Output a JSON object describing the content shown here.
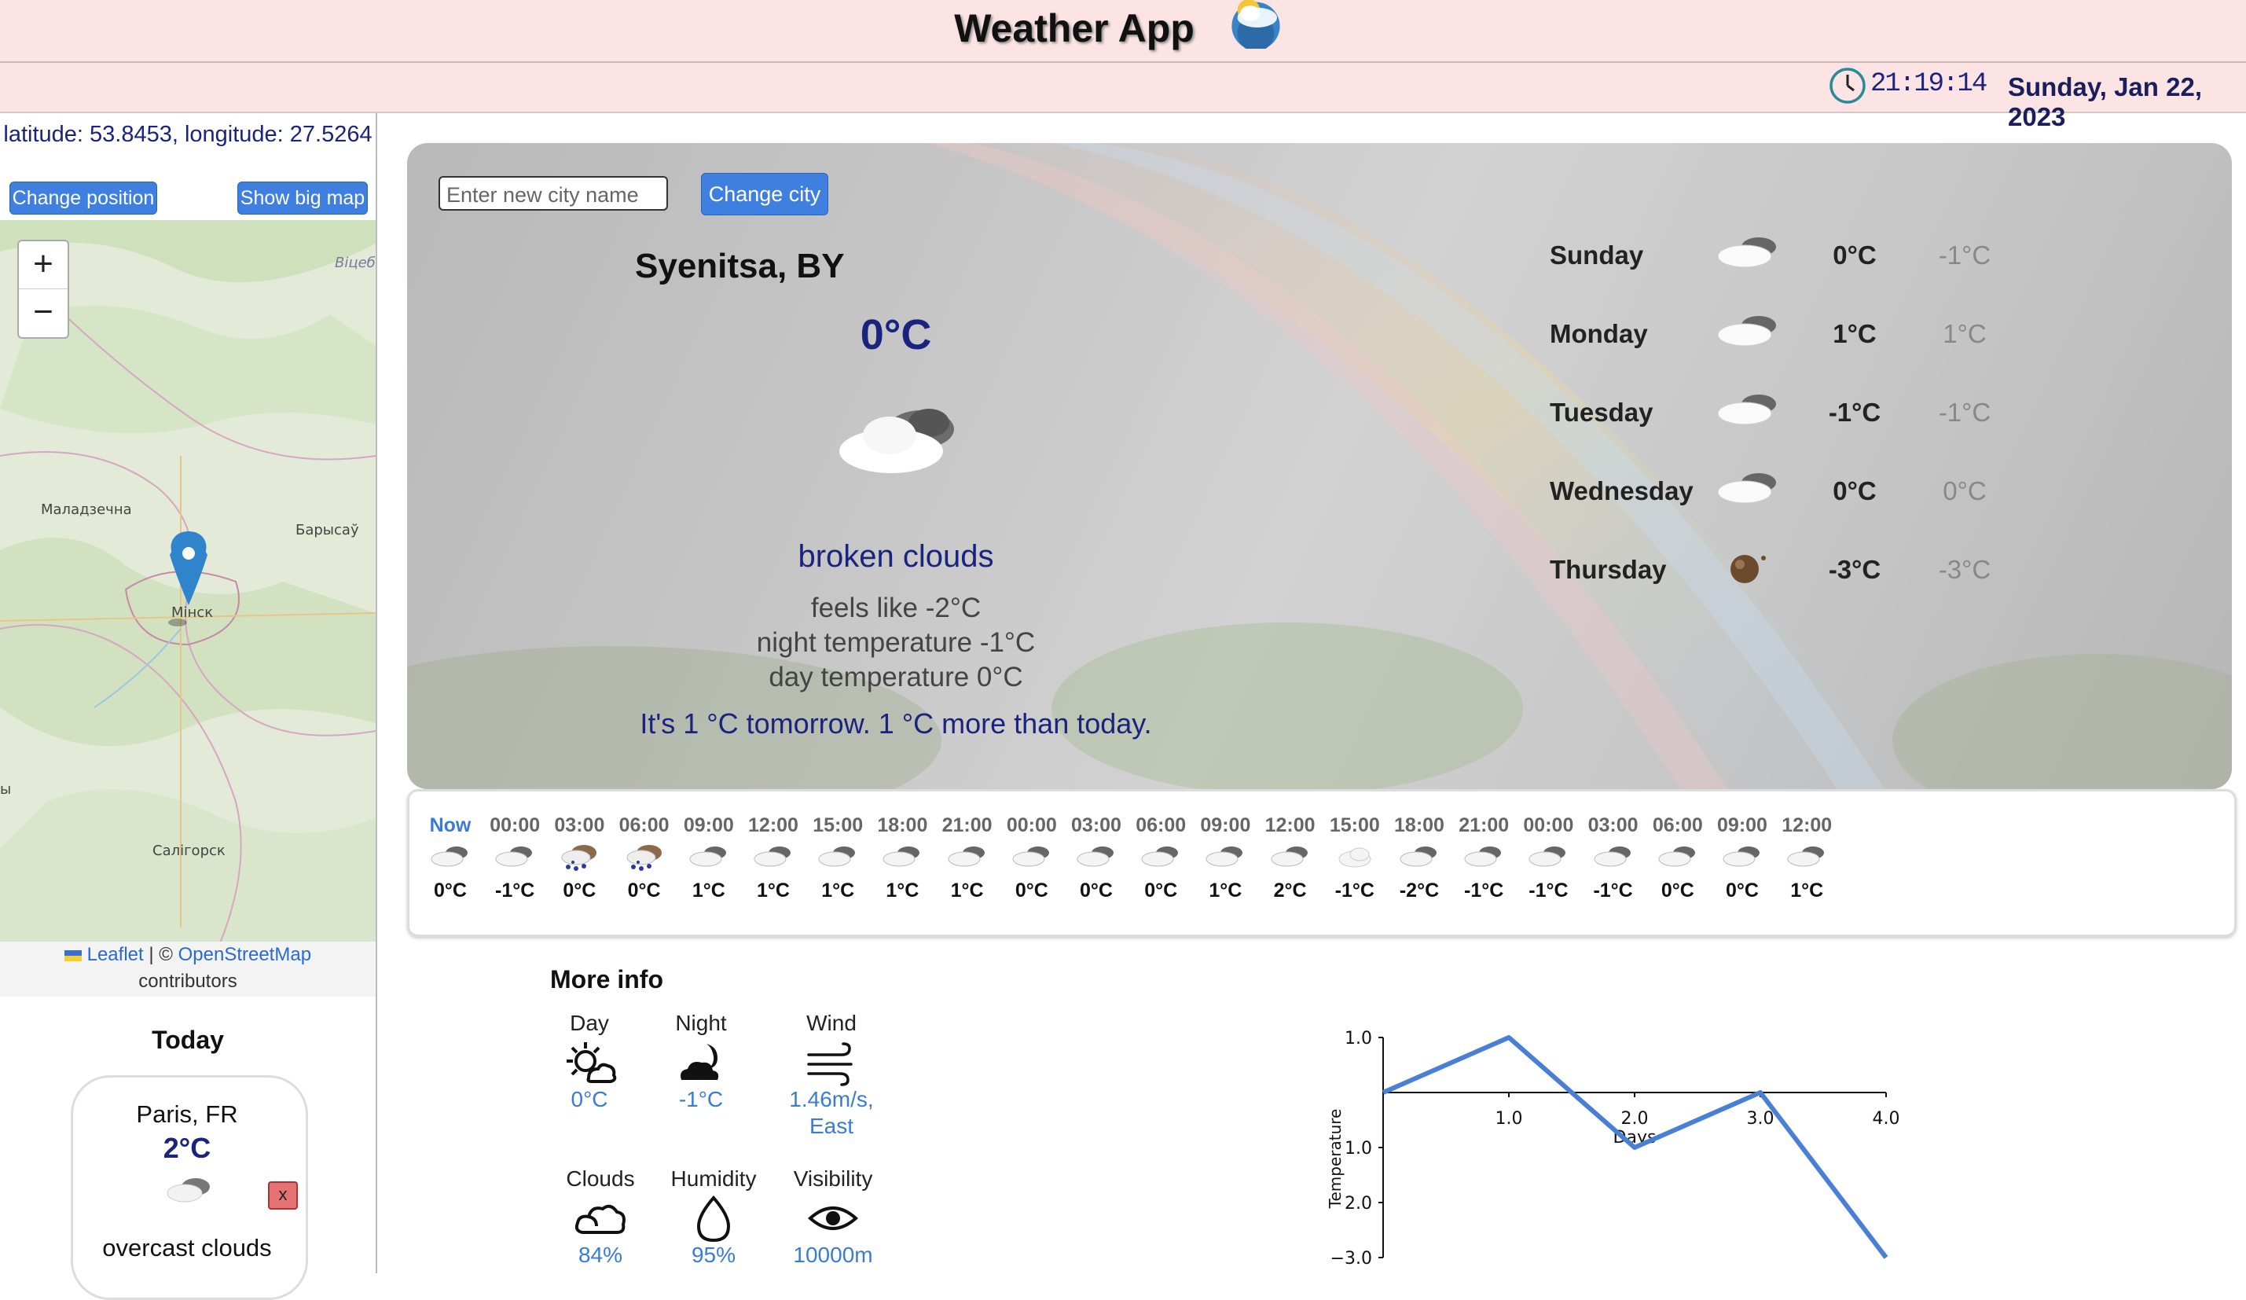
{
  "header": {
    "title": "Weather App",
    "time": "21:19:14",
    "date": "Sunday, Jan 22, 2023"
  },
  "location": {
    "coords": "latitude: 53.8453, longitude: 27.5264",
    "change_position": "Change position",
    "show_big_map": "Show big map"
  },
  "map": {
    "zoom_in": "+",
    "zoom_out": "−",
    "labels": [
      "Віцеб вобл",
      "Маладзечна",
      "Барысаў",
      "Мінск",
      "Салігорск",
      "ы"
    ],
    "attribution_leaflet": "Leaflet",
    "attribution_sep": "| ©",
    "attribution_osm": "OpenStreetMap",
    "attribution_tail": "contributors"
  },
  "today": {
    "title": "Today",
    "city": "Paris, FR",
    "temp": "2°C",
    "desc": "overcast clouds",
    "remove": "x"
  },
  "search": {
    "placeholder": "Enter new city name",
    "button": "Change city"
  },
  "current": {
    "city": "Syenitsa, BY",
    "temp": "0°C",
    "icon": "broken-clouds-icon",
    "desc": "broken clouds",
    "feels": "feels like -2°C",
    "night": "night temperature -1°C",
    "day": "day temperature 0°C",
    "tomorrow": "It's 1 °C tomorrow. 1 °C more than today."
  },
  "forecast": [
    {
      "day": "Sunday",
      "max": "0°C",
      "min": "-1°C",
      "icon": "cloud-icon"
    },
    {
      "day": "Monday",
      "max": "1°C",
      "min": "1°C",
      "icon": "cloud-icon"
    },
    {
      "day": "Tuesday",
      "max": "-1°C",
      "min": "-1°C",
      "icon": "cloud-icon"
    },
    {
      "day": "Wednesday",
      "max": "0°C",
      "min": "0°C",
      "icon": "cloud-icon"
    },
    {
      "day": "Thursday",
      "max": "-3°C",
      "min": "-3°C",
      "icon": "snow-ball-icon"
    }
  ],
  "hourly": [
    {
      "time": "Now",
      "temp": "0°C",
      "icon": "cloud"
    },
    {
      "time": "00:00",
      "temp": "-1°C",
      "icon": "cloud"
    },
    {
      "time": "03:00",
      "temp": "0°C",
      "icon": "snow"
    },
    {
      "time": "06:00",
      "temp": "0°C",
      "icon": "snow"
    },
    {
      "time": "09:00",
      "temp": "1°C",
      "icon": "cloud"
    },
    {
      "time": "12:00",
      "temp": "1°C",
      "icon": "cloud"
    },
    {
      "time": "15:00",
      "temp": "1°C",
      "icon": "cloud"
    },
    {
      "time": "18:00",
      "temp": "1°C",
      "icon": "cloud"
    },
    {
      "time": "21:00",
      "temp": "1°C",
      "icon": "cloud"
    },
    {
      "time": "00:00",
      "temp": "0°C",
      "icon": "cloud"
    },
    {
      "time": "03:00",
      "temp": "0°C",
      "icon": "cloud"
    },
    {
      "time": "06:00",
      "temp": "0°C",
      "icon": "cloud"
    },
    {
      "time": "09:00",
      "temp": "1°C",
      "icon": "cloud"
    },
    {
      "time": "12:00",
      "temp": "2°C",
      "icon": "cloud"
    },
    {
      "time": "15:00",
      "temp": "-1°C",
      "icon": "light-cloud"
    },
    {
      "time": "18:00",
      "temp": "-2°C",
      "icon": "cloud"
    },
    {
      "time": "21:00",
      "temp": "-1°C",
      "icon": "cloud"
    },
    {
      "time": "00:00",
      "temp": "-1°C",
      "icon": "cloud"
    },
    {
      "time": "03:00",
      "temp": "-1°C",
      "icon": "cloud"
    },
    {
      "time": "06:00",
      "temp": "0°C",
      "icon": "cloud"
    },
    {
      "time": "09:00",
      "temp": "0°C",
      "icon": "cloud"
    },
    {
      "time": "12:00",
      "temp": "1°C",
      "icon": "cloud"
    }
  ],
  "more_info": {
    "title": "More info",
    "day": {
      "label": "Day",
      "value": "0°C",
      "icon": "sun-cloud-icon"
    },
    "night": {
      "label": "Night",
      "value": "-1°C",
      "icon": "moon-cloud-icon"
    },
    "wind": {
      "label": "Wind",
      "value": "1.46m/s,",
      "value2": "East",
      "icon": "wind-icon"
    },
    "clouds": {
      "label": "Clouds",
      "value": "84%",
      "icon": "cloud-outline-icon"
    },
    "humidity": {
      "label": "Humidity",
      "value": "95%",
      "icon": "drop-icon"
    },
    "visibility": {
      "label": "Visibility",
      "value": "10000m",
      "icon": "eye-icon"
    }
  },
  "chart_data": {
    "type": "line",
    "x": [
      0,
      1,
      2,
      3,
      4
    ],
    "series": [
      {
        "values": [
          0.0,
          1.0,
          -1.0,
          0.0,
          -3.0
        ]
      }
    ],
    "x_ticks": [
      "1.0",
      "2.0",
      "3.0",
      "4.0"
    ],
    "y_ticks": [
      "1.0",
      "0",
      "-1.0",
      "-2.0",
      "-3.0"
    ],
    "y_tick_labels_shown": [
      "1.0",
      "1.0",
      "2.0",
      "−3.0"
    ],
    "xlabel": "Days",
    "ylabel": "Temperature",
    "xlim": [
      0,
      4
    ],
    "ylim": [
      -3,
      1
    ],
    "line_color": "#4a7fd6"
  }
}
